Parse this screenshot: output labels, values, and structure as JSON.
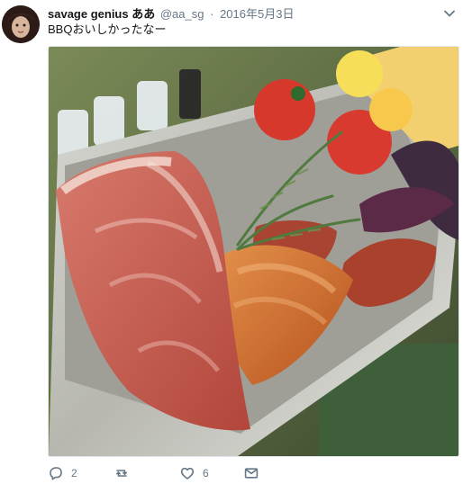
{
  "tweet": {
    "display_name": "savage genius ああ",
    "handle": "@aa_sg",
    "separator": "·",
    "date": "2016年5月3日",
    "text": "BBQおいしかったなー"
  },
  "actions": {
    "reply_count": "2",
    "retweet_count": "",
    "like_count": "6"
  },
  "icons": {
    "menu": "chevron-down-icon",
    "reply": "reply-icon",
    "retweet": "retweet-icon",
    "like": "heart-icon",
    "dm": "envelope-icon"
  },
  "colors": {
    "text_primary": "#14171a",
    "text_secondary": "#657786",
    "icon": "#657786",
    "border": "#e1e8ed"
  }
}
